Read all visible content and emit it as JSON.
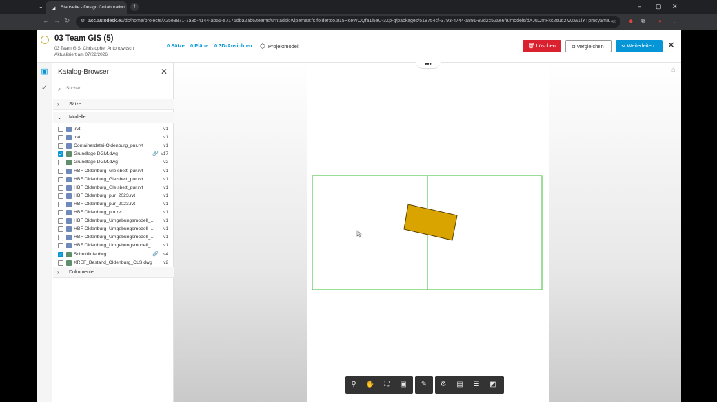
{
  "browser": {
    "tab_title": "Startseite - Design Collaboration",
    "tab_close": "×",
    "new_tab": "+",
    "tab_dropdown": "⌄",
    "window_controls": [
      "–",
      "▢",
      "✕"
    ],
    "nav": [
      "←",
      "→",
      "↻"
    ],
    "url_host": "acc.autodesk.eu",
    "url_path": "/dc/home/projects/725e3871-7a8d-4144-ab55-a7176dba2ab6/teams/urn:adsk.wipemea:fs.folder:co.a15HceWOQfa1l5aU-3Zp-g/packages/518754cf-3793-4744-a891-82d2c52ae6f9/models/dXJuOmFkc2sud2lwZW1lYTpmcy5ma...",
    "extensions": [
      "⌖",
      "☆",
      "◆",
      "⧉",
      "●",
      "⋮"
    ]
  },
  "header": {
    "title": "03 Team GIS (5)",
    "subtitle": "03 Team GIS, Christopher Antonowitsch",
    "updated": "Aktualisiert am 07/22/2026",
    "links": [
      "0 Sätze",
      "0 Pläne",
      "0 3D-Ansichten"
    ],
    "project_model": "Projektmodell",
    "delete_label": "Löschen",
    "compare_label": "Vergleichen",
    "forward_label": "Weiterleiten",
    "close": "✕"
  },
  "panel": {
    "title": "Katalog-Browser",
    "close": "✕",
    "search_placeholder": "Suchen",
    "sections": {
      "saetze": "Sätze",
      "modelle": "Modelle",
      "dokumente": "Dokumente"
    },
    "files": [
      {
        "name": ".rvt",
        "version": "v1",
        "checked": false,
        "type": "rvt",
        "linked": false
      },
      {
        "name": ".rvt",
        "version": "v1",
        "checked": false,
        "type": "rvt",
        "linked": false
      },
      {
        "name": "Containerdatei-Oldenburg_pur.rvt",
        "version": "v1",
        "checked": false,
        "type": "rvt",
        "linked": false
      },
      {
        "name": "Grundlage DGM.dwg",
        "version": "v17",
        "checked": true,
        "type": "dwg",
        "linked": true
      },
      {
        "name": "Grundlage DGM.dwg",
        "version": "v2",
        "checked": false,
        "type": "dwg",
        "linked": false
      },
      {
        "name": "HBF Oldenburg_Gleisbett_pur.rvt",
        "version": "v1",
        "checked": false,
        "type": "rvt",
        "linked": false
      },
      {
        "name": "HBF Oldenburg_Gleisbett_pur.rvt",
        "version": "v1",
        "checked": false,
        "type": "rvt",
        "linked": false
      },
      {
        "name": "HBF Oldenburg_Gleisbett_pur.rvt",
        "version": "v1",
        "checked": false,
        "type": "rvt",
        "linked": false
      },
      {
        "name": "HBF Oldenburg_pur_2023.rvt",
        "version": "v1",
        "checked": false,
        "type": "rvt",
        "linked": false
      },
      {
        "name": "HBF Oldenburg_pur_2023.rvt",
        "version": "v1",
        "checked": false,
        "type": "rvt",
        "linked": false
      },
      {
        "name": "HBF Oldenburg_pur.rvt",
        "version": "v1",
        "checked": false,
        "type": "rvt",
        "linked": false
      },
      {
        "name": "HBF Oldenburg_Umgebungsmodell_...",
        "version": "v1",
        "checked": false,
        "type": "rvt",
        "linked": false
      },
      {
        "name": "HBF Oldenburg_Umgebungsmodell_...",
        "version": "v1",
        "checked": false,
        "type": "rvt",
        "linked": false
      },
      {
        "name": "HBF Oldenburg_Umgebungsmodell_...",
        "version": "v1",
        "checked": false,
        "type": "rvt",
        "linked": false
      },
      {
        "name": "HBF Oldenburg_Umgebungsmodell_...",
        "version": "v1",
        "checked": false,
        "type": "rvt",
        "linked": false
      },
      {
        "name": "Schnittlinie.dwg",
        "version": "v4",
        "checked": true,
        "type": "dwg",
        "linked": true
      },
      {
        "name": "XREF_Bestand_Oldenburg_CLS.dwg",
        "version": "v2",
        "checked": false,
        "type": "dwg",
        "linked": false
      }
    ]
  },
  "viewer": {
    "more": "•••",
    "home": "⌂",
    "colors": {
      "frame": "#55c855",
      "shape_fill": "#d9a300",
      "shape_stroke": "#5a4300"
    },
    "toolbar_icons": [
      "pin-icon",
      "hand-icon",
      "fit-icon",
      "camera-icon",
      "pen-icon",
      "gear-icon",
      "save-icon",
      "layers-icon",
      "fullscreen-icon"
    ]
  }
}
